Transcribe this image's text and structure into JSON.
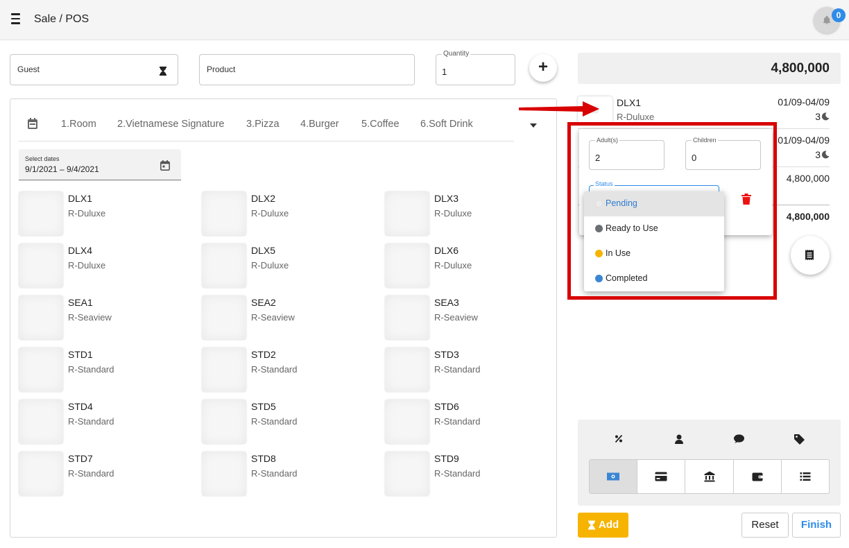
{
  "header": {
    "title": "Sale / POS",
    "notification_count": "0"
  },
  "search": {
    "guest_placeholder": "Guest",
    "product_placeholder": "Product",
    "quantity_label": "Quantity",
    "quantity_value": "1",
    "add_label": "+"
  },
  "tabs": [
    "1.Room",
    "2.Vietnamese Signature",
    "3.Pizza",
    "4.Burger",
    "5.Coffee",
    "6.Soft Drink"
  ],
  "dates": {
    "label": "Select dates",
    "value": "9/1/2021 – 9/4/2021"
  },
  "rooms": [
    {
      "name": "DLX1",
      "type": "R-Duluxe"
    },
    {
      "name": "DLX2",
      "type": "R-Duluxe"
    },
    {
      "name": "DLX3",
      "type": "R-Duluxe"
    },
    {
      "name": "DLX4",
      "type": "R-Duluxe"
    },
    {
      "name": "DLX5",
      "type": "R-Duluxe"
    },
    {
      "name": "DLX6",
      "type": "R-Duluxe"
    },
    {
      "name": "SEA1",
      "type": "R-Seaview"
    },
    {
      "name": "SEA2",
      "type": "R-Seaview"
    },
    {
      "name": "SEA3",
      "type": "R-Seaview"
    },
    {
      "name": "STD1",
      "type": "R-Standard"
    },
    {
      "name": "STD2",
      "type": "R-Standard"
    },
    {
      "name": "STD3",
      "type": "R-Standard"
    },
    {
      "name": "STD4",
      "type": "R-Standard"
    },
    {
      "name": "STD5",
      "type": "R-Standard"
    },
    {
      "name": "STD6",
      "type": "R-Standard"
    },
    {
      "name": "STD7",
      "type": "R-Standard"
    },
    {
      "name": "STD8",
      "type": "R-Standard"
    },
    {
      "name": "STD9",
      "type": "R-Standard"
    }
  ],
  "cart": {
    "total": "4,800,000",
    "item": {
      "name": "DLX1",
      "type": "R-Duluxe",
      "dates": "01/09-04/09",
      "nights": "3"
    },
    "line2": {
      "dates": "01/09-04/09",
      "nights": "3"
    },
    "subtotal": "4,800,000",
    "grand_total": "4,800,000"
  },
  "popup": {
    "adults_label": "Adult(s)",
    "adults_value": "2",
    "children_label": "Children",
    "children_value": "0",
    "status_label": "Status",
    "status_options": [
      {
        "label": "Pending",
        "color": "#e8e8e8"
      },
      {
        "label": "Ready to Use",
        "color": "#6b6f74"
      },
      {
        "label": "In Use",
        "color": "#f6b400"
      },
      {
        "label": "Completed",
        "color": "#3a86d4"
      }
    ]
  },
  "actions": {
    "add_label": "Add",
    "reset_label": "Reset",
    "finish_label": "Finish"
  },
  "colors": {
    "accent": "#2f8be8",
    "warning": "#f6b400",
    "danger": "#d80000"
  }
}
